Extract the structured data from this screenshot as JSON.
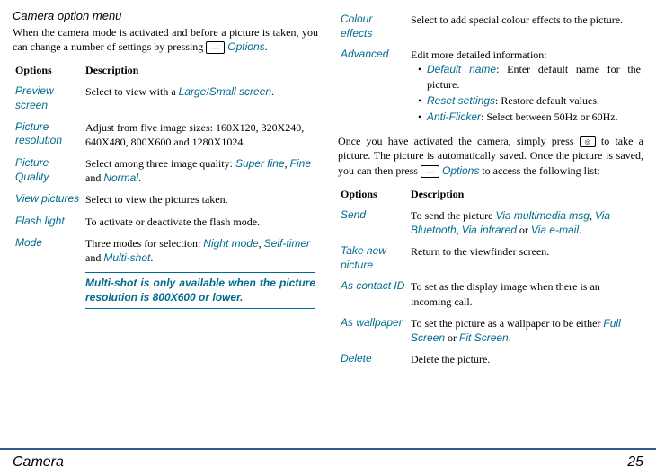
{
  "title": "Camera option menu",
  "intro_a": "When the camera mode is activated and before a picture is taken, you can change a number of settings by pressing ",
  "intro_key": "—",
  "intro_opt": "Options",
  "intro_b": ".",
  "th_opt": "Options",
  "th_desc": "Description",
  "left": [
    {
      "o": "Preview screen",
      "d_a": "Select to view with a ",
      "d_o1": "Large",
      "d_m": "/",
      "d_o2": "Small screen",
      "d_b": "."
    },
    {
      "o": "Picture resolution",
      "d": "Adjust from five image sizes: 160X120, 320X240, 640X480, 800X600 and 1280X1024."
    },
    {
      "o": "Picture Quality",
      "d_a": "Select among three image quality: ",
      "d_o1": "Super fine",
      "d_m1": ", ",
      "d_o2": "Fine",
      "d_m2": " and ",
      "d_o3": "Normal",
      "d_b": "."
    },
    {
      "o": "View pictures",
      "d": "Select to view the pictures taken."
    },
    {
      "o": "Flash light",
      "d": "To activate or deactivate the flash mode."
    },
    {
      "o": "Mode",
      "d_a": "Three modes for selection: ",
      "d_o1": "Night mode",
      "d_m1": ", ",
      "d_o2": "Self-timer",
      "d_m2": " and ",
      "d_o3": "Multi-shot",
      "d_b": "."
    }
  ],
  "note_a": "Multi-shot",
  "note_b": " is only available when the picture resolution is 800X600 or lower.",
  "right1": [
    {
      "o": "Colour effects",
      "d": "Select to add special colour effects to the picture."
    }
  ],
  "adv_o": "Advanced",
  "adv_d": "Edit more detailed information:",
  "adv_items": [
    {
      "o": "Default name",
      "d": ": Enter default name for the picture."
    },
    {
      "o": "Reset settings",
      "d": ": Restore default values."
    },
    {
      "o": "Anti-Flicker",
      "d": ": Select between 50Hz or 60Hz."
    }
  ],
  "mid_a": "Once you have activated the camera, simply press ",
  "mid_key": "◎",
  "mid_b": " to take a picture. The picture is automatically saved. Once the picture is saved, you can then press ",
  "mid_key2": "—",
  "mid_opt": "Options",
  "mid_c": " to access the following list:",
  "right2": [
    {
      "o": "Send",
      "d_a": "To send the picture ",
      "d_o1": "Via multimedia msg",
      "d_m1": ", ",
      "d_o2": "Via Bluetooth",
      "d_m2": ", ",
      "d_o3": "Via infrared",
      "d_m3": " or ",
      "d_o4": "Via e-mail",
      "d_b": "."
    },
    {
      "o": "Take new picture",
      "d": "Return to the viewfinder screen."
    },
    {
      "o": "As contact ID",
      "d": "To set as the display image when there is an incoming call."
    },
    {
      "o": "As wallpaper",
      "d_a": "To set the picture as a wallpaper to be either ",
      "d_o1": "Full Screen",
      "d_m1": " or ",
      "d_o2": "Fit Screen",
      "d_b": "."
    },
    {
      "o": "Delete",
      "d": "Delete the picture."
    }
  ],
  "footer": "Camera",
  "pagenum": "25"
}
